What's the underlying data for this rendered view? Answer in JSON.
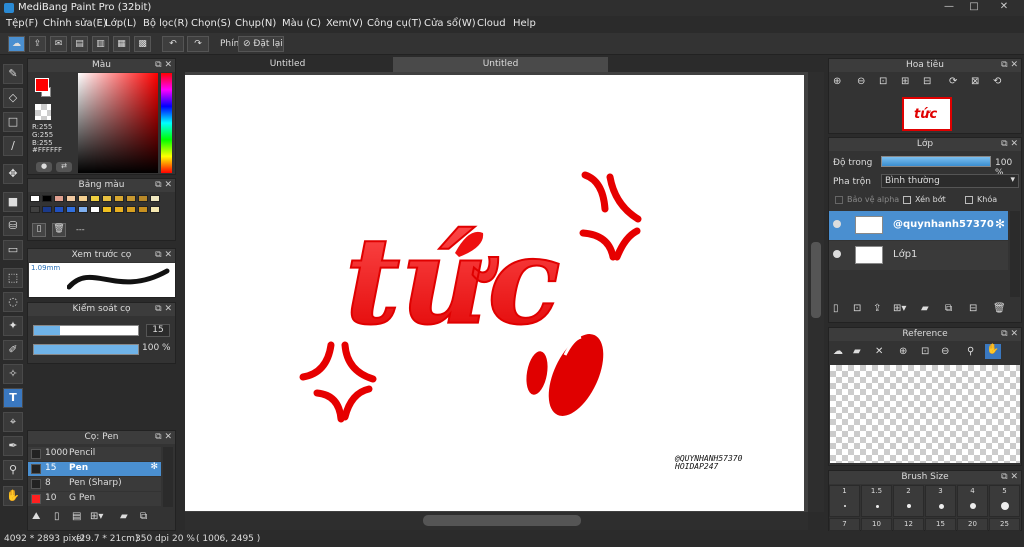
{
  "window": {
    "title": "MediBang Paint Pro (32bit)",
    "minimize": "—",
    "maximize": "□",
    "close": "✕"
  },
  "menu": [
    "Tệp(F)",
    "Chỉnh sửa(E)",
    "Lớp(L)",
    "Bộ lọc(R)",
    "Chọn(S)",
    "Chụp(N)",
    "Màu (C)",
    "Xem(V)",
    "Công cụ(T)",
    "Cửa sổ(W)",
    "Cloud",
    "Help"
  ],
  "toolbar": {
    "shortcut_label": "Phím",
    "reset_label": "Đặt lại"
  },
  "tabs": [
    "Untitled",
    "Untitled"
  ],
  "color_panel": {
    "title": "Màu",
    "r": "R:255",
    "g": "G:255",
    "b": "B:255",
    "hex": "#FFFFFF",
    "fg": "#ff0000",
    "bg": "#ffffff"
  },
  "palette_panel": {
    "title": "Bảng màu",
    "footer": "---",
    "colors": [
      "#ffffff",
      "#000000",
      "#e0a090",
      "#f0c8a0",
      "#f5d090",
      "#f0d040",
      "#e8c040",
      "#d8a830",
      "#c89830",
      "#b88828",
      "#f0e8c0",
      "#404040",
      "#1b3a8a",
      "#2050c0",
      "#3070e0",
      "#80b0f0",
      "#ffffff",
      "#f0c020",
      "#e8b020",
      "#d8a020",
      "#c89020",
      "#f5e8b0"
    ]
  },
  "brush_preview": {
    "title": "Xem trước cọ",
    "size": "1.09mm"
  },
  "brush_control": {
    "title": "Kiểm soát cọ",
    "size_value": "15",
    "opacity_value": "100 %",
    "size_fill": 0.25,
    "opacity_fill": 1.0
  },
  "brush_list": {
    "title": "Cọ: Pen",
    "items": [
      {
        "size": "1000",
        "name": "Pencil",
        "color": "#222222",
        "selected": false
      },
      {
        "size": "15",
        "name": "Pen",
        "color": "#222222",
        "selected": true
      },
      {
        "size": "8",
        "name": "Pen (Sharp)",
        "color": "#222222",
        "selected": false
      },
      {
        "size": "10",
        "name": "G Pen",
        "color": "#ff2020",
        "selected": false
      }
    ]
  },
  "canvas_art": {
    "word": "tức",
    "signature1": "@QUYNHANH57370",
    "signature2": "HOIDAP247"
  },
  "navigator": {
    "title": "Hoa tiêu",
    "thumb_text": "tức"
  },
  "layer_panel": {
    "title": "Lớp",
    "opacity_label": "Độ trong",
    "opacity_value": "100 %",
    "opacity_fill": 1.0,
    "blend_label": "Pha trộn",
    "blend_value": "Bình thường",
    "protect_alpha": "Bảo vệ alpha",
    "clip": "Xén bớt",
    "lock": "Khóa",
    "layers": [
      {
        "name": "@quynhanh57370",
        "selected": true
      },
      {
        "name": "Lớp1",
        "selected": false
      }
    ]
  },
  "reference_panel": {
    "title": "Reference"
  },
  "brush_size_panel": {
    "title": "Brush Size",
    "sizes_row1": [
      "1",
      "1.5",
      "2",
      "3",
      "4",
      "5"
    ],
    "sizes_row2": [
      "7",
      "10",
      "12",
      "15",
      "20",
      "25"
    ]
  },
  "status": {
    "dims": "4092 * 2893 pixel",
    "cm": "(29.7 * 21cm)",
    "dpi": "350 dpi",
    "zoom": "20 %",
    "coord": "( 1006, 2495 )"
  }
}
